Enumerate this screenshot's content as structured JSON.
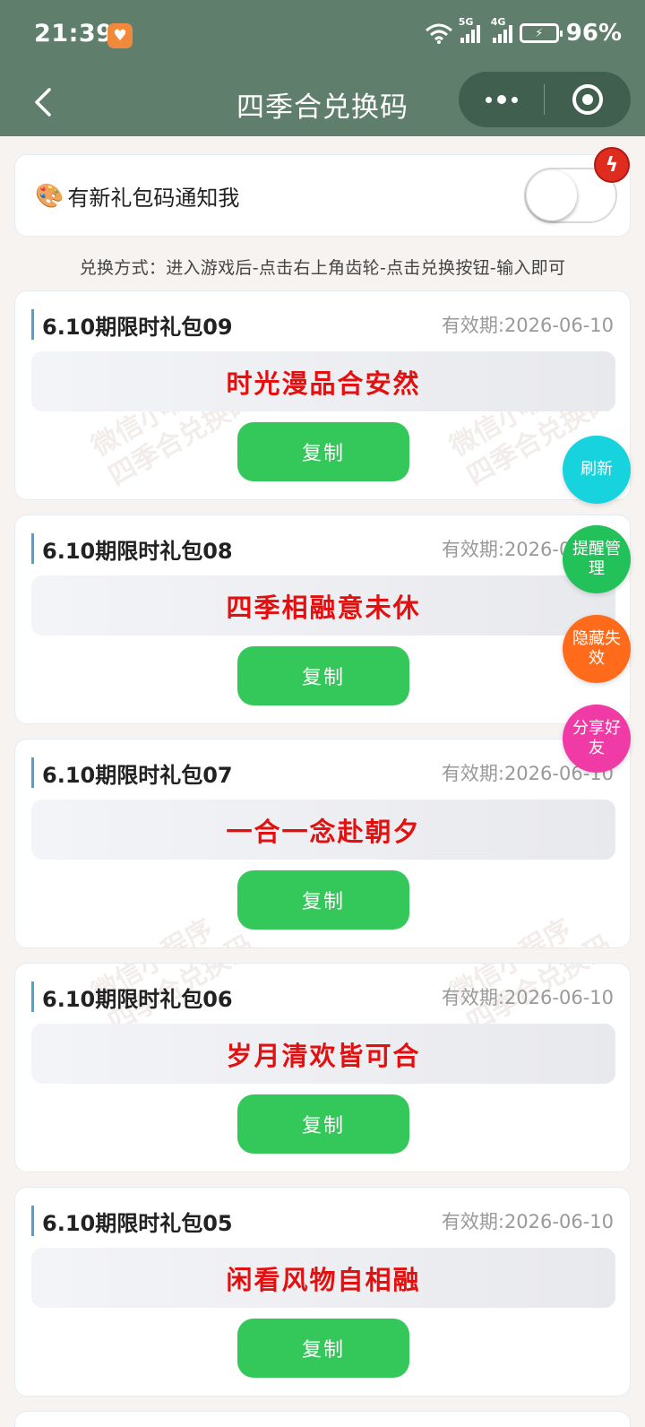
{
  "status_bar": {
    "time": "21:39",
    "signal1_label": "5G",
    "signal2_label": "4G",
    "battery_percent": "96%"
  },
  "navbar": {
    "title": "四季合兑换码"
  },
  "notify": {
    "label": "有新礼包码通知我",
    "toggle_on": false
  },
  "instructions": "兑换方式：进入游戏后-点击右上角齿轮-点击兑换按钮-输入即可",
  "watermark_text": [
    "微信小程序",
    "四季合兑换码"
  ],
  "gifts": [
    {
      "name": "6.10期限时礼包09",
      "expiry": "有效期:2026-06-10",
      "code": "时光漫品合安然",
      "copy_label": "复制"
    },
    {
      "name": "6.10期限时礼包08",
      "expiry": "有效期:2026-06-10",
      "code": "四季相融意未休",
      "copy_label": "复制"
    },
    {
      "name": "6.10期限时礼包07",
      "expiry": "有效期:2026-06-10",
      "code": "一合一念赴朝夕",
      "copy_label": "复制"
    },
    {
      "name": "6.10期限时礼包06",
      "expiry": "有效期:2026-06-10",
      "code": "岁月清欢皆可合",
      "copy_label": "复制"
    },
    {
      "name": "6.10期限时礼包05",
      "expiry": "有效期:2026-06-10",
      "code": "闲看风物自相融",
      "copy_label": "复制"
    }
  ],
  "float_buttons": [
    {
      "label": "刷新",
      "color": "#17d3de"
    },
    {
      "label": "提醒管理",
      "color": "#22c15a"
    },
    {
      "label": "隐藏失效",
      "color": "#ff6b1a"
    },
    {
      "label": "分享好友",
      "color": "#f03aa5"
    }
  ],
  "colors": {
    "header": "#5f7f6c",
    "code_text": "#e31010",
    "copy_button": "#34c759"
  }
}
